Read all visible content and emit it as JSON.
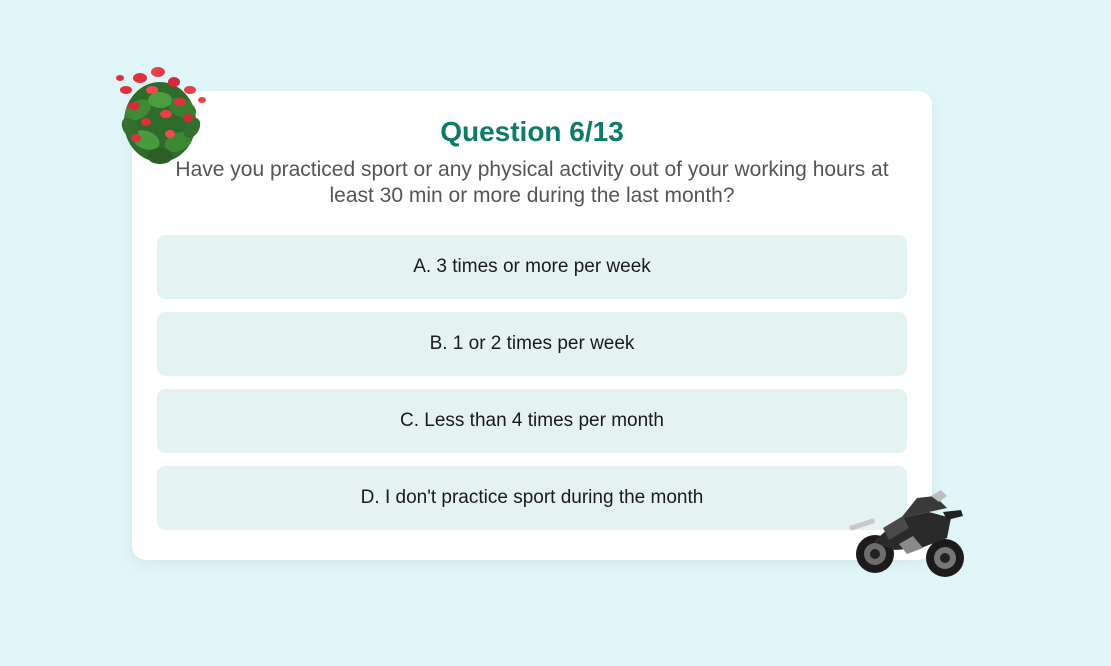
{
  "quiz": {
    "title": "Question 6/13",
    "question": "Have you practiced sport or any physical activity out of your working hours at least 30 min or more during the last month?",
    "options": [
      {
        "label": "A. 3 times or more per week"
      },
      {
        "label": "B. 1 or 2 times per week"
      },
      {
        "label": "C. Less than 4 times per month"
      },
      {
        "label": "D. I don't practice sport during the month"
      }
    ]
  },
  "decorations": {
    "top_left": "flower-plant-icon",
    "bottom_right": "motorcycle-icon"
  },
  "colors": {
    "page_background": "#dff5f7",
    "title": "#0d7a6a",
    "option_background": "#e4f3f2"
  }
}
